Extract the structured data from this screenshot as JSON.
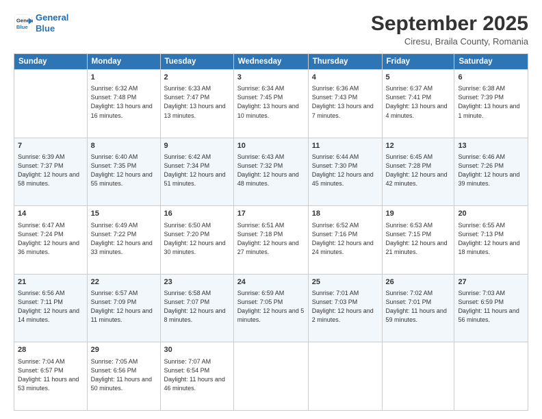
{
  "header": {
    "logo_line1": "General",
    "logo_line2": "Blue",
    "month": "September 2025",
    "location": "Ciresu, Braila County, Romania"
  },
  "weekdays": [
    "Sunday",
    "Monday",
    "Tuesday",
    "Wednesday",
    "Thursday",
    "Friday",
    "Saturday"
  ],
  "weeks": [
    [
      {
        "day": "",
        "sunrise": "",
        "sunset": "",
        "daylight": ""
      },
      {
        "day": "1",
        "sunrise": "Sunrise: 6:32 AM",
        "sunset": "Sunset: 7:48 PM",
        "daylight": "Daylight: 13 hours and 16 minutes."
      },
      {
        "day": "2",
        "sunrise": "Sunrise: 6:33 AM",
        "sunset": "Sunset: 7:47 PM",
        "daylight": "Daylight: 13 hours and 13 minutes."
      },
      {
        "day": "3",
        "sunrise": "Sunrise: 6:34 AM",
        "sunset": "Sunset: 7:45 PM",
        "daylight": "Daylight: 13 hours and 10 minutes."
      },
      {
        "day": "4",
        "sunrise": "Sunrise: 6:36 AM",
        "sunset": "Sunset: 7:43 PM",
        "daylight": "Daylight: 13 hours and 7 minutes."
      },
      {
        "day": "5",
        "sunrise": "Sunrise: 6:37 AM",
        "sunset": "Sunset: 7:41 PM",
        "daylight": "Daylight: 13 hours and 4 minutes."
      },
      {
        "day": "6",
        "sunrise": "Sunrise: 6:38 AM",
        "sunset": "Sunset: 7:39 PM",
        "daylight": "Daylight: 13 hours and 1 minute."
      }
    ],
    [
      {
        "day": "7",
        "sunrise": "Sunrise: 6:39 AM",
        "sunset": "Sunset: 7:37 PM",
        "daylight": "Daylight: 12 hours and 58 minutes."
      },
      {
        "day": "8",
        "sunrise": "Sunrise: 6:40 AM",
        "sunset": "Sunset: 7:35 PM",
        "daylight": "Daylight: 12 hours and 55 minutes."
      },
      {
        "day": "9",
        "sunrise": "Sunrise: 6:42 AM",
        "sunset": "Sunset: 7:34 PM",
        "daylight": "Daylight: 12 hours and 51 minutes."
      },
      {
        "day": "10",
        "sunrise": "Sunrise: 6:43 AM",
        "sunset": "Sunset: 7:32 PM",
        "daylight": "Daylight: 12 hours and 48 minutes."
      },
      {
        "day": "11",
        "sunrise": "Sunrise: 6:44 AM",
        "sunset": "Sunset: 7:30 PM",
        "daylight": "Daylight: 12 hours and 45 minutes."
      },
      {
        "day": "12",
        "sunrise": "Sunrise: 6:45 AM",
        "sunset": "Sunset: 7:28 PM",
        "daylight": "Daylight: 12 hours and 42 minutes."
      },
      {
        "day": "13",
        "sunrise": "Sunrise: 6:46 AM",
        "sunset": "Sunset: 7:26 PM",
        "daylight": "Daylight: 12 hours and 39 minutes."
      }
    ],
    [
      {
        "day": "14",
        "sunrise": "Sunrise: 6:47 AM",
        "sunset": "Sunset: 7:24 PM",
        "daylight": "Daylight: 12 hours and 36 minutes."
      },
      {
        "day": "15",
        "sunrise": "Sunrise: 6:49 AM",
        "sunset": "Sunset: 7:22 PM",
        "daylight": "Daylight: 12 hours and 33 minutes."
      },
      {
        "day": "16",
        "sunrise": "Sunrise: 6:50 AM",
        "sunset": "Sunset: 7:20 PM",
        "daylight": "Daylight: 12 hours and 30 minutes."
      },
      {
        "day": "17",
        "sunrise": "Sunrise: 6:51 AM",
        "sunset": "Sunset: 7:18 PM",
        "daylight": "Daylight: 12 hours and 27 minutes."
      },
      {
        "day": "18",
        "sunrise": "Sunrise: 6:52 AM",
        "sunset": "Sunset: 7:16 PM",
        "daylight": "Daylight: 12 hours and 24 minutes."
      },
      {
        "day": "19",
        "sunrise": "Sunrise: 6:53 AM",
        "sunset": "Sunset: 7:15 PM",
        "daylight": "Daylight: 12 hours and 21 minutes."
      },
      {
        "day": "20",
        "sunrise": "Sunrise: 6:55 AM",
        "sunset": "Sunset: 7:13 PM",
        "daylight": "Daylight: 12 hours and 18 minutes."
      }
    ],
    [
      {
        "day": "21",
        "sunrise": "Sunrise: 6:56 AM",
        "sunset": "Sunset: 7:11 PM",
        "daylight": "Daylight: 12 hours and 14 minutes."
      },
      {
        "day": "22",
        "sunrise": "Sunrise: 6:57 AM",
        "sunset": "Sunset: 7:09 PM",
        "daylight": "Daylight: 12 hours and 11 minutes."
      },
      {
        "day": "23",
        "sunrise": "Sunrise: 6:58 AM",
        "sunset": "Sunset: 7:07 PM",
        "daylight": "Daylight: 12 hours and 8 minutes."
      },
      {
        "day": "24",
        "sunrise": "Sunrise: 6:59 AM",
        "sunset": "Sunset: 7:05 PM",
        "daylight": "Daylight: 12 hours and 5 minutes."
      },
      {
        "day": "25",
        "sunrise": "Sunrise: 7:01 AM",
        "sunset": "Sunset: 7:03 PM",
        "daylight": "Daylight: 12 hours and 2 minutes."
      },
      {
        "day": "26",
        "sunrise": "Sunrise: 7:02 AM",
        "sunset": "Sunset: 7:01 PM",
        "daylight": "Daylight: 11 hours and 59 minutes."
      },
      {
        "day": "27",
        "sunrise": "Sunrise: 7:03 AM",
        "sunset": "Sunset: 6:59 PM",
        "daylight": "Daylight: 11 hours and 56 minutes."
      }
    ],
    [
      {
        "day": "28",
        "sunrise": "Sunrise: 7:04 AM",
        "sunset": "Sunset: 6:57 PM",
        "daylight": "Daylight: 11 hours and 53 minutes."
      },
      {
        "day": "29",
        "sunrise": "Sunrise: 7:05 AM",
        "sunset": "Sunset: 6:56 PM",
        "daylight": "Daylight: 11 hours and 50 minutes."
      },
      {
        "day": "30",
        "sunrise": "Sunrise: 7:07 AM",
        "sunset": "Sunset: 6:54 PM",
        "daylight": "Daylight: 11 hours and 46 minutes."
      },
      {
        "day": "",
        "sunrise": "",
        "sunset": "",
        "daylight": ""
      },
      {
        "day": "",
        "sunrise": "",
        "sunset": "",
        "daylight": ""
      },
      {
        "day": "",
        "sunrise": "",
        "sunset": "",
        "daylight": ""
      },
      {
        "day": "",
        "sunrise": "",
        "sunset": "",
        "daylight": ""
      }
    ]
  ]
}
